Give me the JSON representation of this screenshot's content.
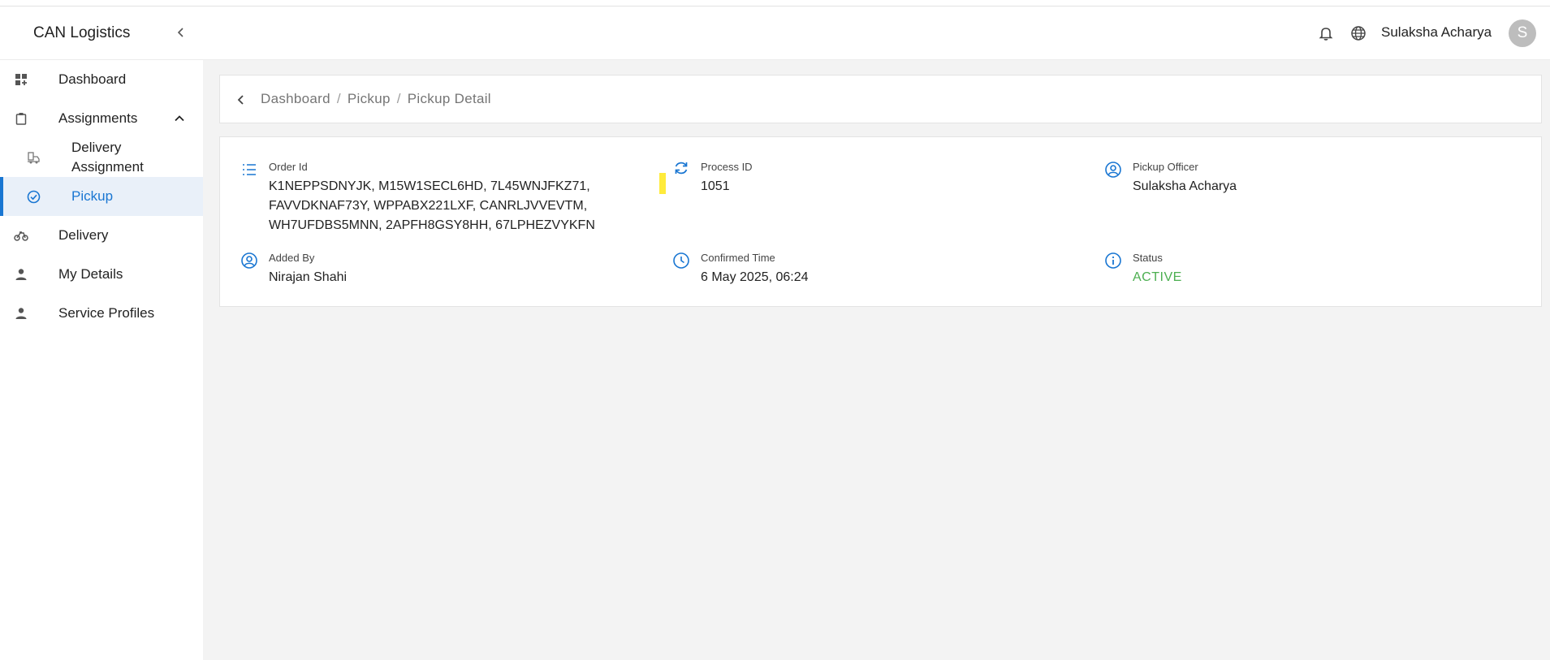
{
  "app": {
    "title": "CAN Logistics"
  },
  "sidebar": {
    "items": [
      {
        "label": "Dashboard",
        "icon": "dashboard-icon"
      },
      {
        "label": "Assignments",
        "icon": "clipboard-icon"
      },
      {
        "label": "Delivery Assignment",
        "label_line1": "Delivery",
        "label_line2": "Assignment",
        "icon": "delivery-assignment-icon"
      },
      {
        "label": "Pickup",
        "icon": "check-circle-icon"
      },
      {
        "label": "Delivery",
        "icon": "bike-icon"
      },
      {
        "label": "My Details",
        "icon": "person-icon"
      },
      {
        "label": "Service Profiles",
        "icon": "person-icon"
      }
    ]
  },
  "header": {
    "user_name": "Sulaksha Acharya",
    "avatar_initial": "S"
  },
  "breadcrumb": {
    "items": [
      "Dashboard",
      "Pickup",
      "Pickup Detail"
    ],
    "separator": "/"
  },
  "detail": {
    "order_id": {
      "label": "Order Id",
      "line1": "K1NEPPSDNYJK, M15W1SECL6HD, 7L45WNJFKZ71,",
      "line2": "FAVVDKNAF73Y, WPPABX221LXF, CANRLJVVEVTM,",
      "line3": "WH7UFDBS5MNN, 2APFH8GSY8HH, 67LPHEZVYKFN"
    },
    "process_id": {
      "label": "Process ID",
      "value": "1051"
    },
    "pickup_officer": {
      "label": "Pickup Officer",
      "value": "Sulaksha Acharya"
    },
    "added_by": {
      "label": "Added By",
      "value": "Nirajan Shahi"
    },
    "confirmed_time": {
      "label": "Confirmed Time",
      "value": "6 May 2025, 06:24"
    },
    "status": {
      "label": "Status",
      "value": "ACTIVE"
    }
  },
  "colors": {
    "accent": "#1976d2",
    "active_bg": "#e9f0f9",
    "status_active": "#4caf50",
    "marker": "#ffeb3b",
    "page_bg": "#f3f3f3"
  }
}
